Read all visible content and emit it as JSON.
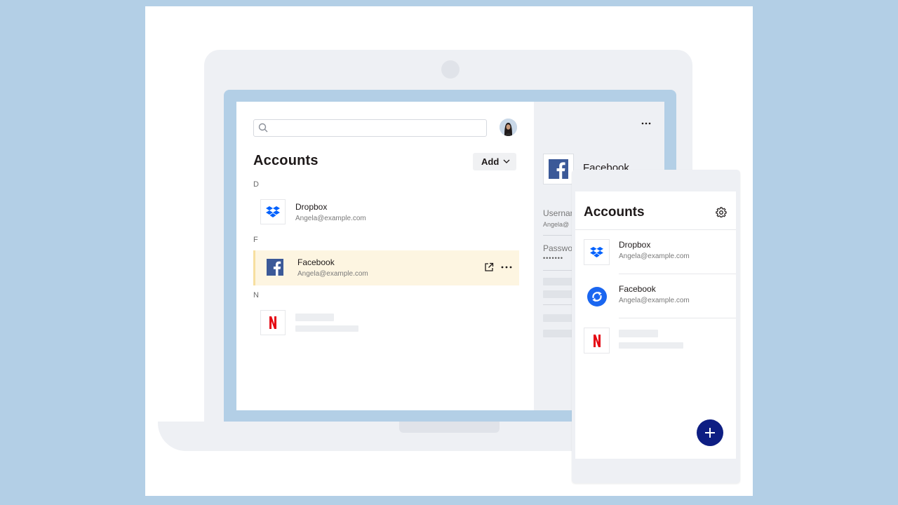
{
  "desktop": {
    "search": {
      "placeholder": ""
    },
    "title": "Accounts",
    "add_label": "Add",
    "sections": {
      "d": "D",
      "f": "F",
      "n": "N"
    },
    "items": [
      {
        "name": "Dropbox",
        "email": "Angela@example.com",
        "icon": "dropbox-logo"
      },
      {
        "name": "Facebook",
        "email": "Angela@example.com",
        "icon": "facebook-logo",
        "selected": true
      },
      {
        "name": "",
        "email": "",
        "icon": "netflix-logo"
      }
    ]
  },
  "detail": {
    "name": "Facebook",
    "username_label": "Usernar",
    "username_value": "Angela@",
    "password_label": "Passwo",
    "password_value": "•••••••"
  },
  "mobile": {
    "title": "Accounts",
    "items": [
      {
        "name": "Dropbox",
        "email": "Angela@example.com",
        "icon": "dropbox-logo"
      },
      {
        "name": "Facebook",
        "email": "Angela@example.com",
        "icon": "sync-icon"
      },
      {
        "name": "",
        "email": "",
        "icon": "netflix-logo"
      }
    ]
  },
  "colors": {
    "background": "#b3cfe6",
    "selected_row": "#fdf5e1",
    "fab": "#0e1e83",
    "dropbox": "#0061fe",
    "facebook": "#3b5998",
    "netflix": "#e50914"
  }
}
